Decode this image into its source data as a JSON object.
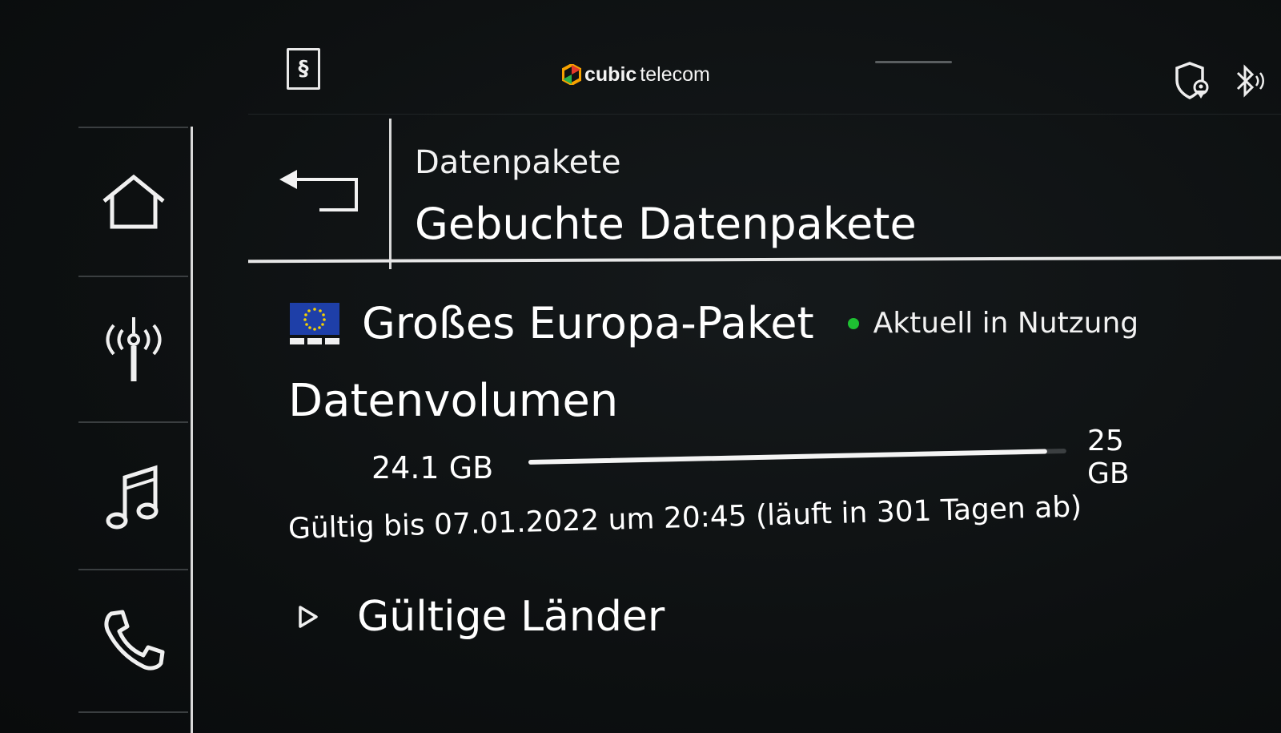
{
  "topbar": {
    "legal_symbol": "§",
    "brand_bold": "cubic",
    "brand_light": "telecom",
    "icons": [
      "privacy-location-shield-icon",
      "bluetooth-audio-icon"
    ]
  },
  "sidebar": {
    "items": [
      {
        "icon": "home-icon"
      },
      {
        "icon": "radio-antenna-icon"
      },
      {
        "icon": "music-note-icon"
      },
      {
        "icon": "phone-icon"
      }
    ]
  },
  "header": {
    "back_icon": "back-arrow-icon",
    "breadcrumb": "Datenpakete",
    "title": "Gebuchte Datenpakete"
  },
  "package": {
    "flag_icon": "eu-flag-icon",
    "name": "Großes Europa-Paket",
    "status": "Aktuell in Nutzung",
    "status_color": "#1ec032"
  },
  "volume": {
    "title": "Datenvolumen",
    "used": "24.1 GB",
    "total": "25 GB",
    "fraction": 0.964
  },
  "validity": "Gültig bis 07.01.2022 um 20:45 (läuft in 301 Tagen ab)",
  "countries": {
    "label": "Gültige Länder",
    "expander_icon": "play-triangle-icon"
  }
}
